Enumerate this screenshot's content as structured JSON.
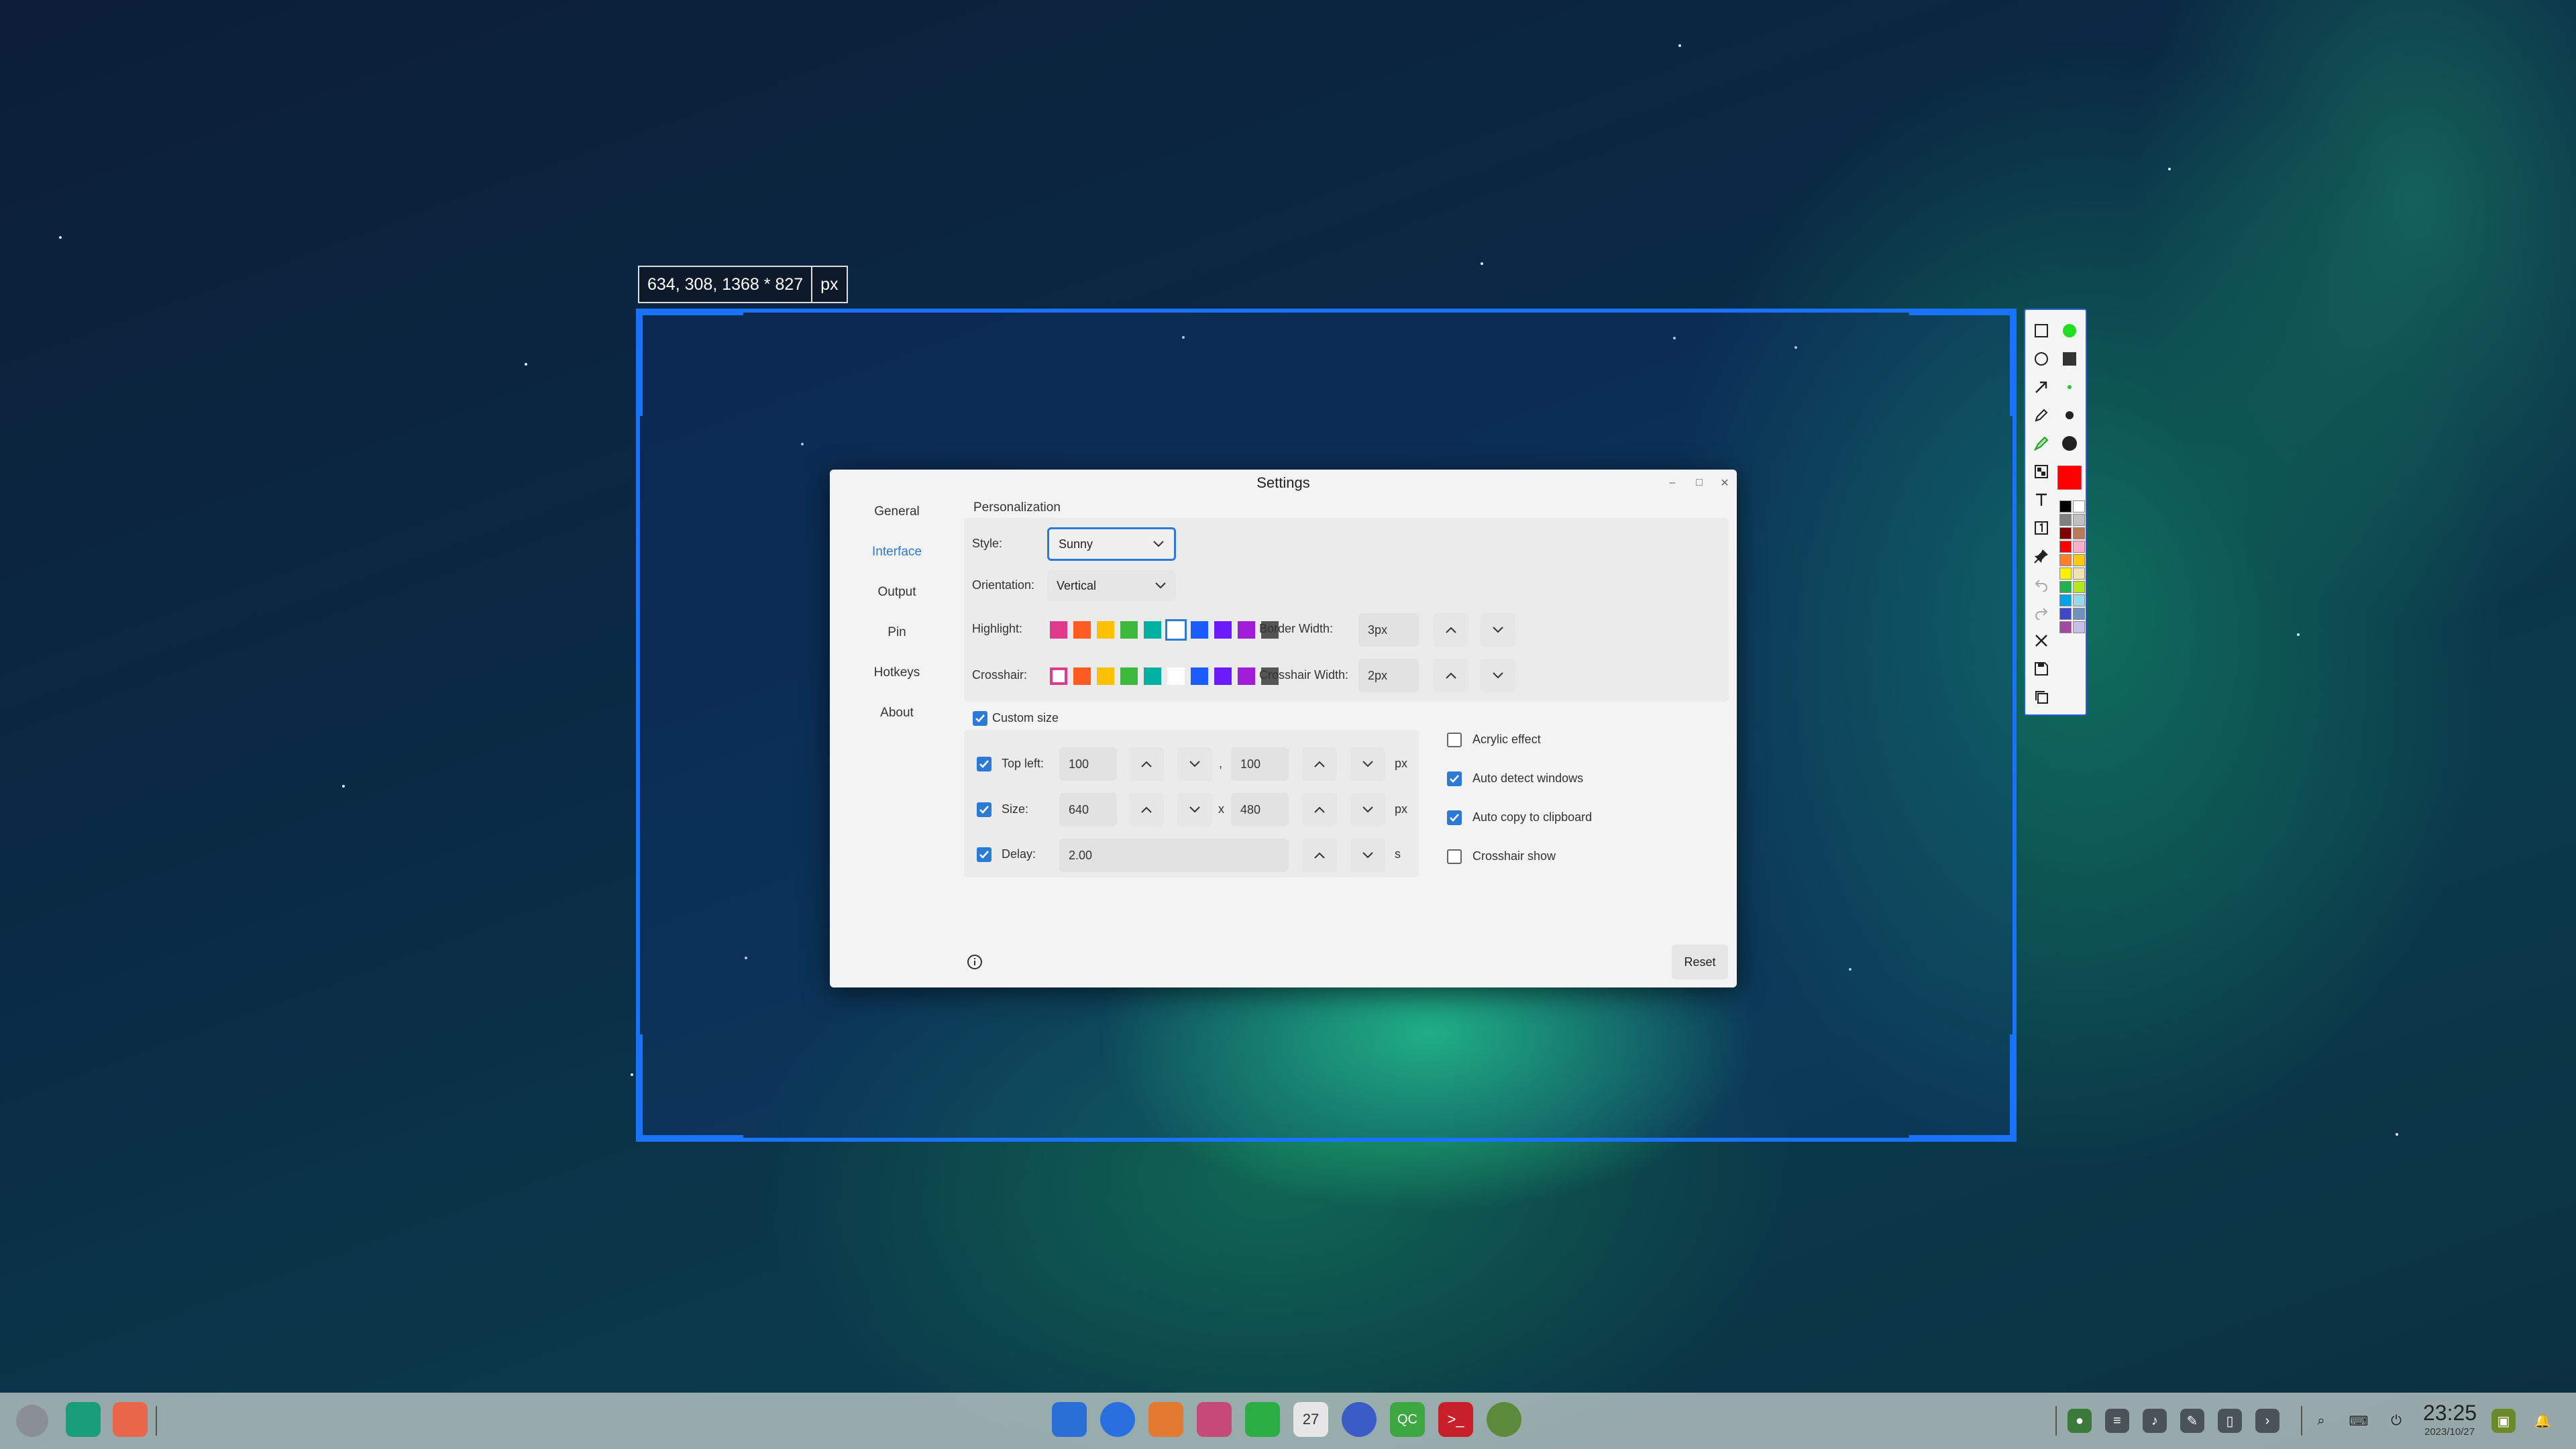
{
  "selection": {
    "coords_text": "634, 308, 1368 * 827",
    "unit": "px",
    "accent_color": "#1a73ff"
  },
  "draw_toolbar": {
    "tools": [
      "rectangle-icon",
      "ellipse-icon",
      "arrow-icon",
      "pencil-icon",
      "marker-icon",
      "mosaic-icon",
      "text-icon",
      "number-icon",
      "pin-icon",
      "undo-icon",
      "redo-icon",
      "close-icon",
      "save-icon",
      "copy-icon"
    ],
    "current_color": "#ff0000",
    "palette": [
      "#000000",
      "#ffffff",
      "#808080",
      "#c0c0c0",
      "#800000",
      "#b97a57",
      "#ff0000",
      "#ffaec9",
      "#ff7f27",
      "#ffc90e",
      "#fff200",
      "#efe4b0",
      "#22b14c",
      "#b5e61d",
      "#00a2e8",
      "#99d9ea",
      "#3f48cc",
      "#7092be",
      "#a349a4",
      "#c8bfe7"
    ]
  },
  "settings": {
    "title": "Settings",
    "nav": [
      "General",
      "Interface",
      "Output",
      "Pin",
      "Hotkeys",
      "About"
    ],
    "active_nav": "Interface",
    "personalization_label": "Personalization",
    "style_label": "Style:",
    "style_value": "Sunny",
    "orientation_label": "Orientation:",
    "orientation_value": "Vertical",
    "highlight_label": "Highlight:",
    "crosshair_label": "Crosshair:",
    "swatch_colors": [
      "#e03a8c",
      "#ff5a1f",
      "#ffc000",
      "#3cb93c",
      "#00b0a0",
      "#ffffff",
      "#1a5cff",
      "#6a1cff",
      "#a01cd8",
      "#555555"
    ],
    "border_width_label": "Border Width:",
    "border_width_value": "3px",
    "crosshair_width_label": "Crosshair Width:",
    "crosshair_width_value": "2px",
    "custom_size_label": "Custom size",
    "top_left_label": "Top left:",
    "top_left_x": "100",
    "top_left_y": "100",
    "separator_comma": ",",
    "size_label": "Size:",
    "size_w": "640",
    "size_h": "480",
    "separator_x": "x",
    "delay_label": "Delay:",
    "delay_value": "2.00",
    "unit_px": "px",
    "unit_s": "s",
    "acrylic_label": "Acrylic effect",
    "auto_detect_label": "Auto detect windows",
    "auto_copy_label": "Auto copy to clipboard",
    "crosshair_show_label": "Crosshair show",
    "reset_label": "Reset",
    "accent_color": "#2b7bd6"
  },
  "taskbar": {
    "clock_time": "23:25",
    "clock_date": "2023/10/27",
    "calendar_day": "27"
  }
}
